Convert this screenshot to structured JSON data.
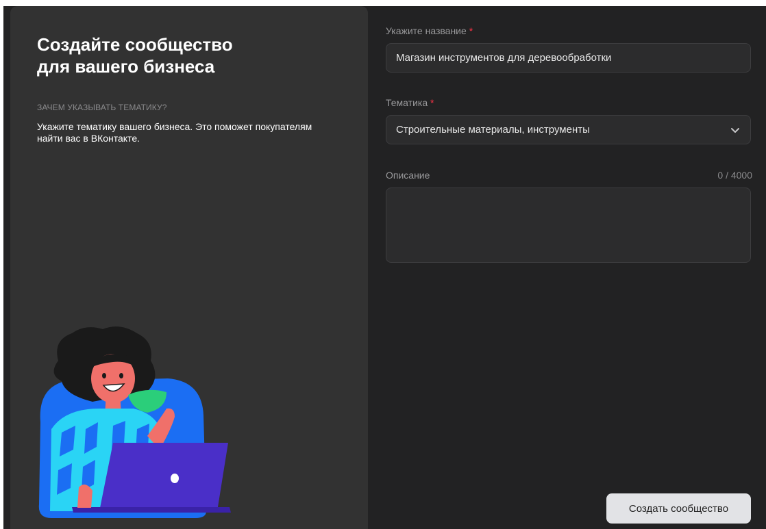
{
  "intro": {
    "title_line1": "Создайте сообщество",
    "title_line2": "для вашего бизнеса",
    "why_label": "Зачем указывать тематику?",
    "why_text": "Укажите тематику вашего бизнеса. Это поможет покупателям найти вас в ВКонтакте."
  },
  "form": {
    "name": {
      "label": "Укажите название",
      "required_mark": "*",
      "value": "Магазин инструментов для деревообработки"
    },
    "topic": {
      "label": "Тематика",
      "required_mark": "*",
      "value": "Строительные материалы, инструменты",
      "icon": "chevron-down-icon"
    },
    "description": {
      "label": "Описание",
      "counter": "0 / 4000",
      "value": ""
    },
    "submit_label": "Создать сообщество"
  },
  "colors": {
    "accent_required": "#ff3347",
    "panel_dark": "#222223",
    "panel_left": "#323232"
  }
}
